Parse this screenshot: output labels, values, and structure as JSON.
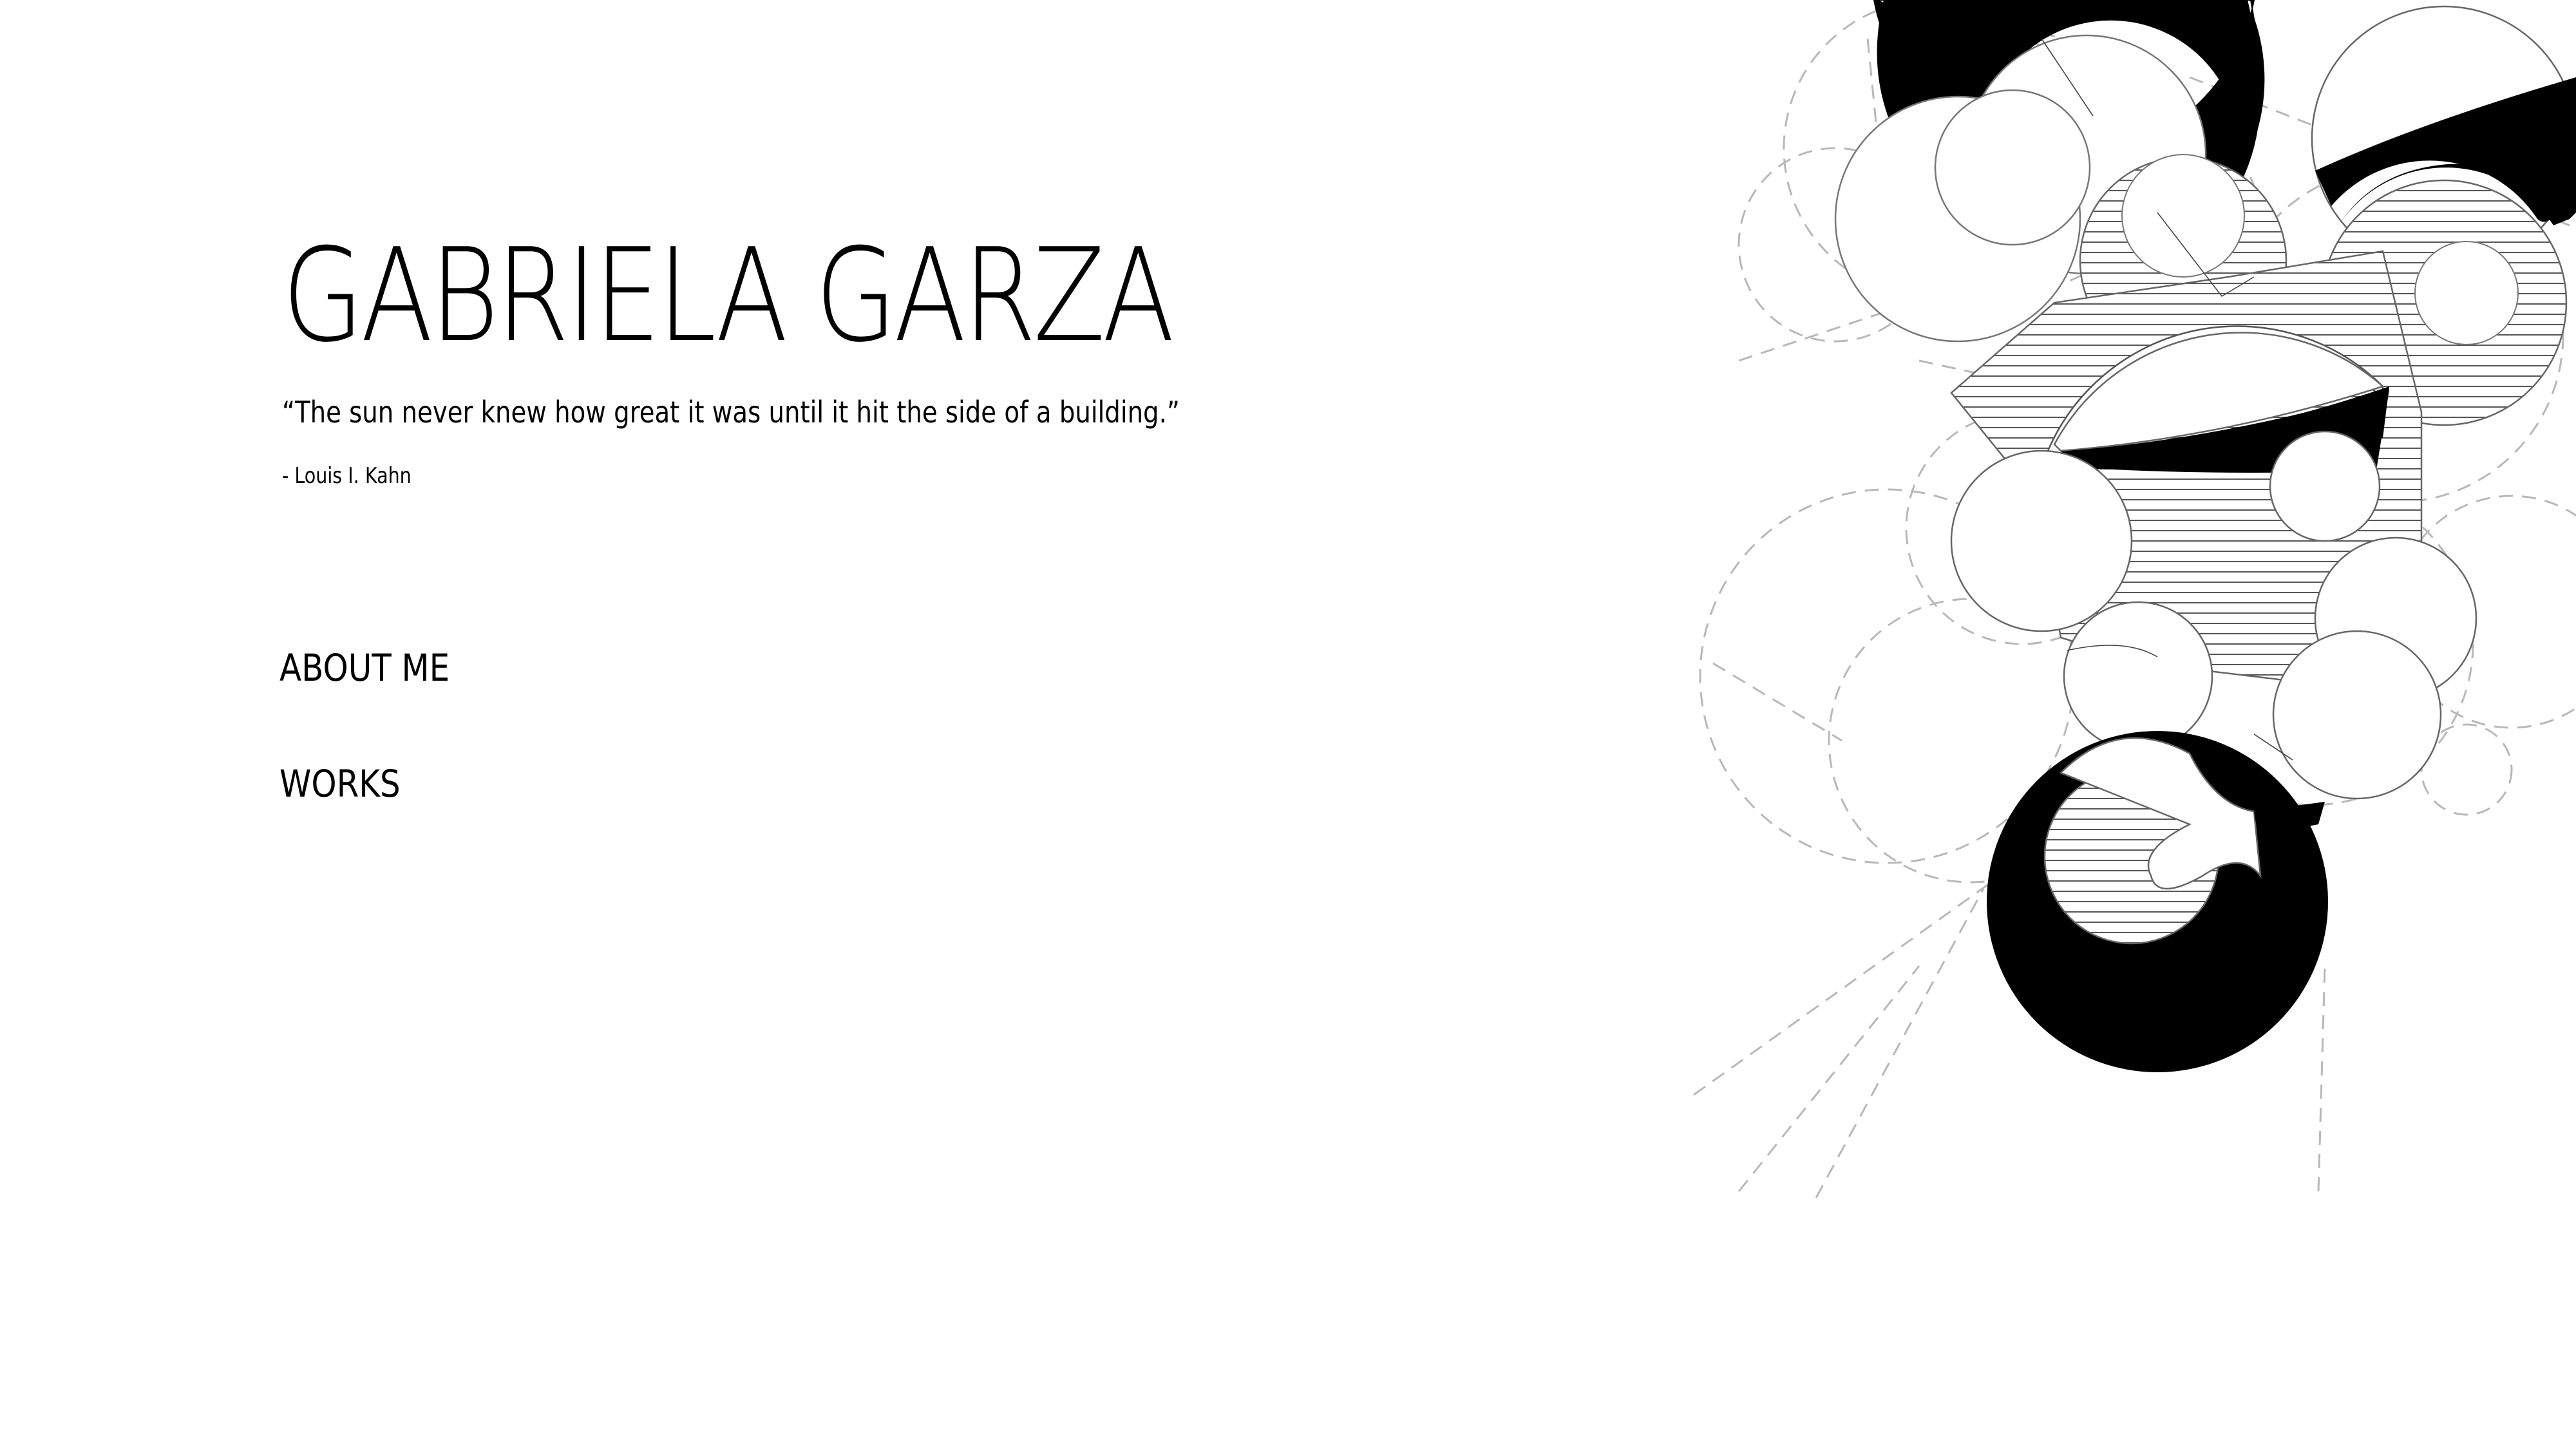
{
  "header": {
    "name": "GABRIELA GARZA",
    "quote": "“The sun never knew how great it was until it hit the side of a building.”",
    "attribution": "- Louis I. Kahn"
  },
  "nav": {
    "about_label": "ABOUT ME",
    "works_label": "WORKS"
  },
  "colors": {
    "background": "#ffffff",
    "foreground": "#000000",
    "line": "#555555",
    "dashed": "#b5b5b5"
  }
}
